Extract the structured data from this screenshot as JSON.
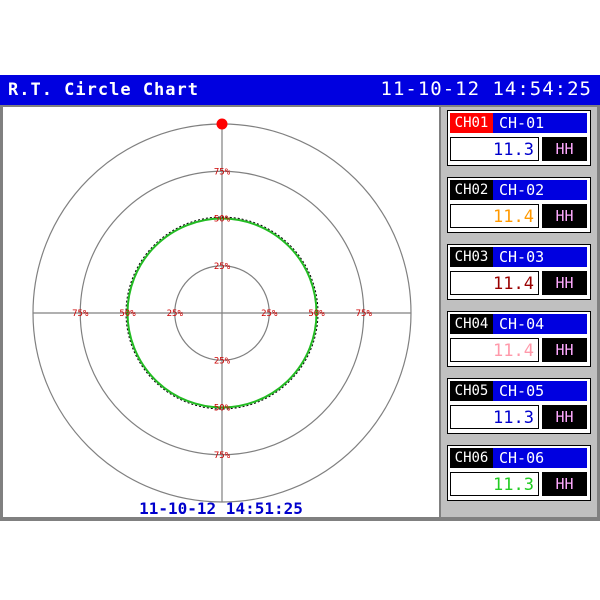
{
  "header": {
    "title": "R.T. Circle Chart",
    "clock": "11-10-12 14:54:25"
  },
  "chart": {
    "timestamp": "11-10-12 14:51:25"
  },
  "chart_data": {
    "type": "polar",
    "rings_percent": [
      25,
      50,
      75,
      100
    ],
    "ring_labels": {
      "up": [
        "75%",
        "50%",
        "25%"
      ],
      "down": [
        "25%",
        "50%",
        "75%"
      ],
      "left": [
        "75%",
        "50%",
        "25%"
      ],
      "right": [
        "25%",
        "50%",
        "75%"
      ]
    },
    "series": [
      {
        "values_percent": 50,
        "color": "#22bb22"
      }
    ],
    "marker_color": "#ff0000"
  },
  "channels": [
    {
      "id": "CH01",
      "name": "CH-01",
      "value": "11.3",
      "alarm": "HH",
      "id_bg": "#ff0000",
      "value_color": "#0000cc"
    },
    {
      "id": "CH02",
      "name": "CH-02",
      "value": "11.4",
      "alarm": "HH",
      "id_bg": "#000000",
      "value_color": "#ff9900"
    },
    {
      "id": "CH03",
      "name": "CH-03",
      "value": "11.4",
      "alarm": "HH",
      "id_bg": "#000000",
      "value_color": "#990000"
    },
    {
      "id": "CH04",
      "name": "CH-04",
      "value": "11.4",
      "alarm": "HH",
      "id_bg": "#000000",
      "value_color": "#ff99aa"
    },
    {
      "id": "CH05",
      "name": "CH-05",
      "value": "11.3",
      "alarm": "HH",
      "id_bg": "#000000",
      "value_color": "#0000cc"
    },
    {
      "id": "CH06",
      "name": "CH-06",
      "value": "11.3",
      "alarm": "HH",
      "id_bg": "#000000",
      "value_color": "#22cc22"
    }
  ],
  "colors": {
    "title_bar": "#0000e0",
    "ring_label": "#cc0000",
    "grid": "#808080",
    "alarm_text": "#ffaaff"
  }
}
